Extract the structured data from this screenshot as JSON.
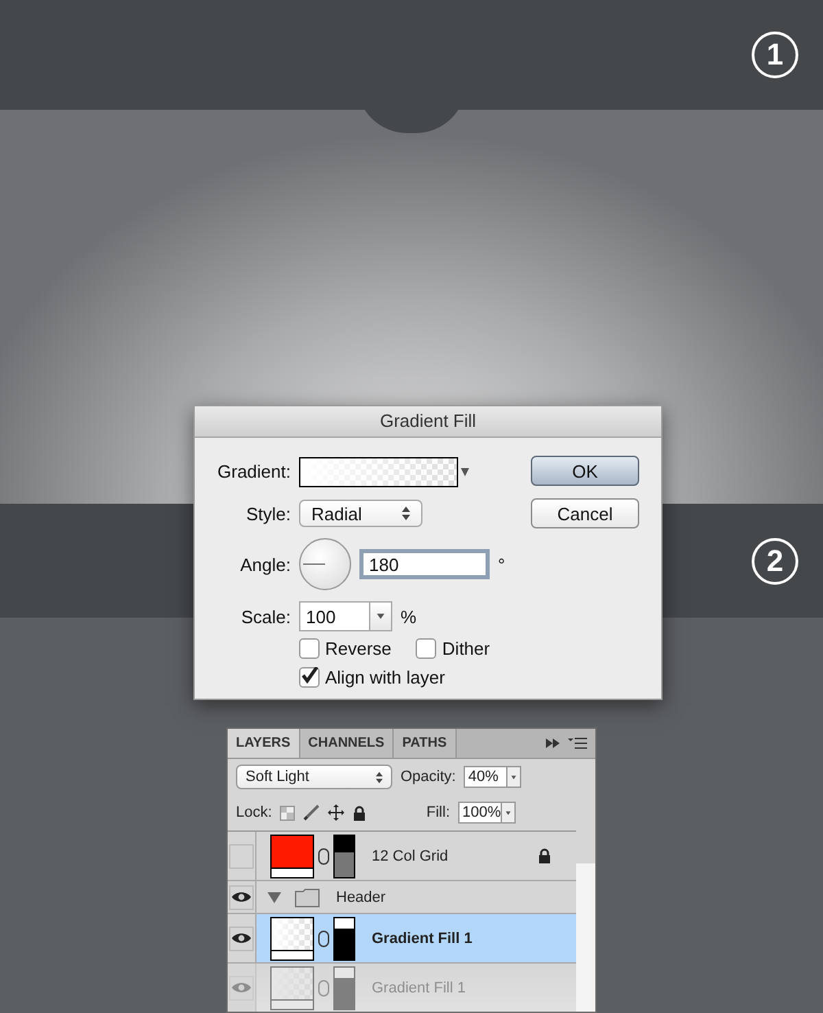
{
  "steps": [
    {
      "number": "1"
    },
    {
      "number": "2"
    }
  ],
  "dialog": {
    "title": "Gradient Fill",
    "gradient_label": "Gradient:",
    "style_label": "Style:",
    "style_value": "Radial",
    "angle_label": "Angle:",
    "angle_value": "180",
    "angle_unit": "°",
    "scale_label": "Scale:",
    "scale_value": "100",
    "scale_unit": "%",
    "options": [
      {
        "label": "Reverse",
        "checked": false
      },
      {
        "label": "Dither",
        "checked": false
      },
      {
        "label": "Align with layer",
        "checked": true
      }
    ],
    "buttons": [
      {
        "label": "OK",
        "default": true
      },
      {
        "label": "Cancel",
        "default": false
      }
    ]
  },
  "layers_panel": {
    "tabs": [
      {
        "label": "LAYERS",
        "selected": true
      },
      {
        "label": "CHANNELS",
        "selected": false
      },
      {
        "label": "PATHS",
        "selected": false
      }
    ],
    "blend_mode": "Soft Light",
    "opacity_label": "Opacity:",
    "opacity_value": "40%",
    "lock_label": "Lock:",
    "fill_label": "Fill:",
    "fill_value": "100%",
    "layers": [
      {
        "kind": "solid",
        "name": "12 Col Grid",
        "color": "#ff1a00",
        "visible": false,
        "selected": false,
        "locked": true
      },
      {
        "kind": "group",
        "name": "Header",
        "visible": true,
        "selected": false,
        "expanded": true,
        "children": [
          {
            "kind": "gradient",
            "name": "Gradient Fill 1",
            "visible": true,
            "selected": true,
            "locked": false
          },
          {
            "kind": "gradient",
            "name": "Gradient Fill 1",
            "visible": true,
            "selected": false,
            "locked": false
          }
        ]
      }
    ]
  }
}
